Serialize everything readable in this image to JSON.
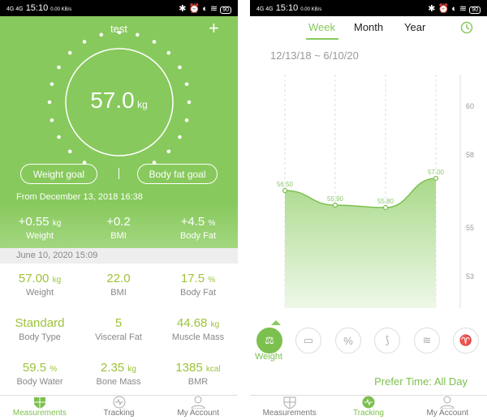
{
  "status_bar": {
    "time": "15:10",
    "network": "4G 4G",
    "speed": "0.00 KB/s",
    "battery": "90"
  },
  "measurements": {
    "title": "test",
    "add_icon": "plus-icon",
    "weight_value": "57.0",
    "weight_unit": "kg",
    "weight_goal": "Weight goal",
    "body_fat_goal": "Body fat goal",
    "from_text": "From December 13, 2018 16:38",
    "changes": [
      {
        "value": "+0.55",
        "unit": "kg",
        "label": "Weight"
      },
      {
        "value": "+0.2",
        "unit": "",
        "label": "BMI"
      },
      {
        "value": "+4.5",
        "unit": "%",
        "label": "Body Fat"
      }
    ],
    "date": "June 10, 2020 15:09",
    "metrics": [
      {
        "value": "57.00",
        "unit": "kg",
        "label": "Weight"
      },
      {
        "value": "22.0",
        "unit": "",
        "label": "BMI"
      },
      {
        "value": "17.5",
        "unit": "%",
        "label": "Body Fat"
      },
      {
        "value": "Standard",
        "unit": "",
        "label": "Body Type"
      },
      {
        "value": "5",
        "unit": "",
        "label": "Visceral Fat"
      },
      {
        "value": "44.68",
        "unit": "kg",
        "label": "Muscle Mass"
      },
      {
        "value": "59.5",
        "unit": "%",
        "label": "Body Water"
      },
      {
        "value": "2.35",
        "unit": "kg",
        "label": "Bone Mass"
      },
      {
        "value": "1385",
        "unit": "kcal",
        "label": "BMR"
      }
    ]
  },
  "tracking": {
    "tabs": [
      "Week",
      "Month",
      "Year"
    ],
    "active_tab": "Week",
    "history_icon": "clock-icon",
    "date_range": "12/13/18 ~ 6/10/20",
    "metric_icons": [
      "weight-icon",
      "ruler-icon",
      "percent-icon",
      "bone-icon",
      "muscle-icon",
      "kidney-icon"
    ],
    "selected_metric": "Weight",
    "prefer_time": "Prefer Time: All Day"
  },
  "nav": [
    {
      "label": "Measurements",
      "icon": "shield-icon"
    },
    {
      "label": "Tracking",
      "icon": "pulse-icon"
    },
    {
      "label": "My Account",
      "icon": "person-icon"
    }
  ],
  "colors": {
    "accent": "#87c95c",
    "value": "#9cc33a"
  },
  "chart_data": {
    "type": "area",
    "points": [
      {
        "label": "56.50",
        "y": 56.5
      },
      {
        "label": "55.90",
        "y": 55.9
      },
      {
        "label": "55.80",
        "y": 55.8
      },
      {
        "label": "57.00",
        "y": 57.0
      }
    ],
    "y_ticks": [
      "60",
      "58",
      "55",
      "53"
    ],
    "grid": "vertical dashed"
  }
}
